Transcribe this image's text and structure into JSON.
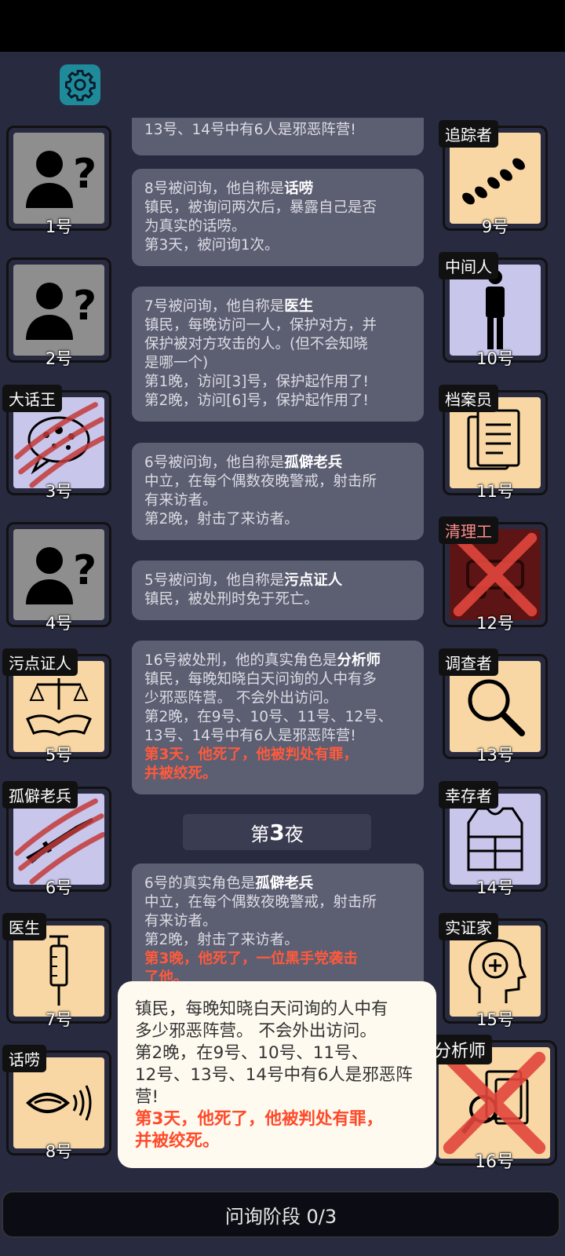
{
  "header": {
    "settings_icon": "gear-icon"
  },
  "players": {
    "p1": {
      "num": "1号",
      "role": "",
      "icon": "unknown-person-icon"
    },
    "p2": {
      "num": "2号",
      "role": "",
      "icon": "unknown-person-icon"
    },
    "p3": {
      "num": "3号",
      "role": "大话王",
      "icon": "speech-bubble-icon",
      "dead": true
    },
    "p4": {
      "num": "4号",
      "role": "",
      "icon": "unknown-person-icon"
    },
    "p5": {
      "num": "5号",
      "role": "污点证人",
      "icon": "scales-handshake-icon"
    },
    "p6": {
      "num": "6号",
      "role": "孤僻老兵",
      "icon": "rifle-icon",
      "dead": true
    },
    "p7": {
      "num": "7号",
      "role": "医生",
      "icon": "syringe-icon"
    },
    "p8": {
      "num": "8号",
      "role": "话唠",
      "icon": "mouth-talking-icon"
    },
    "p9": {
      "num": "9号",
      "role": "追踪者",
      "icon": "footprints-icon"
    },
    "p10": {
      "num": "10号",
      "role": "中间人",
      "icon": "standing-man-icon"
    },
    "p11": {
      "num": "11号",
      "role": "档案员",
      "icon": "documents-icon"
    },
    "p12": {
      "num": "12号",
      "role": "清理工",
      "icon": "vehicle-icon",
      "dead": true
    },
    "p13": {
      "num": "13号",
      "role": "调查者",
      "icon": "magnifier-icon"
    },
    "p14": {
      "num": "14号",
      "role": "幸存者",
      "icon": "vest-icon"
    },
    "p15": {
      "num": "15号",
      "role": "实证家",
      "icon": "head-plus-icon"
    },
    "p16": {
      "num": "16号",
      "role": "分析师",
      "icon": "magnifier-docs-icon",
      "dead": true
    }
  },
  "feed": {
    "m0": {
      "line": "13号、14号中有6人是邪恶阵营!"
    },
    "m1": {
      "pre": "8号被问询，他自称是",
      "role": "话唠",
      "l1": "镇民，被询问两次后，暴露自己是否",
      "l2": "为真实的话唠。",
      "l3": "第3天，被问询1次。"
    },
    "m2": {
      "pre": "7号被问询，他自称是",
      "role": "医生",
      "l1": "镇民，每晚访问一人，保护对方，并",
      "l2": "保护被对方攻击的人。(但不会知晓",
      "l3": "是哪一个)",
      "l4": "第1晚，访问[3]号，保护起作用了!",
      "l5": "第2晚，访问[6]号，保护起作用了!"
    },
    "m3": {
      "pre": "6号被问询，他自称是",
      "role": "孤僻老兵",
      "l1": "中立，在每个偶数夜晚警戒，射击所",
      "l2": "有来访者。",
      "l3": "第2晚，射击了来访者。"
    },
    "m4": {
      "pre": "5号被问询，他自称是",
      "role": "污点证人",
      "l1": "镇民，被处刑时免于死亡。"
    },
    "m5": {
      "pre": "16号被处刑，他的真实角色是",
      "role": "分析师",
      "l1": "镇民，每晚知晓白天问询的人中有多",
      "l2": "少邪恶阵营。 不会外出访问。",
      "l3": "第2晚，在9号、10号、11号、12号、",
      "l4": "13号、14号中有6人是邪恶阵营!",
      "r1": "第3天，他死了，他被判处有罪，",
      "r2": "并被绞死。"
    },
    "night_pre": "第",
    "night_num": "3",
    "night_post": "夜",
    "m6": {
      "pre": "6号的真实角色是",
      "role": "孤僻老兵",
      "l1": "中立，在每个偶数夜晚警戒，射击所",
      "l2": "有来访者。",
      "l3": "第2晚，射击了来访者。",
      "r1": "第3晚，他死了，一位黑手党袭击",
      "r2": "了他。"
    }
  },
  "tooltip": {
    "l1": "镇民，每晚知晓白天问询的人中有",
    "l2": "多少邪恶阵营。 不会外出访问。",
    "l3": "第2晚，在9号、10号、11号、",
    "l4": "12号、13号、14号中有6人是邪恶阵",
    "l5": "营!",
    "r1": "第3天，他死了，他被判处有罪，",
    "r2": "并被绞死。"
  },
  "footer": {
    "phase": "问询阶段 0/3"
  },
  "colors": {
    "background": "#282a40",
    "gear_bg": "#1e8a9a",
    "highlight_red": "#ff4a2a",
    "card_gray": "#8e8e8e",
    "card_lavender": "#c8c6ea",
    "card_peach": "#f8d7a4"
  }
}
